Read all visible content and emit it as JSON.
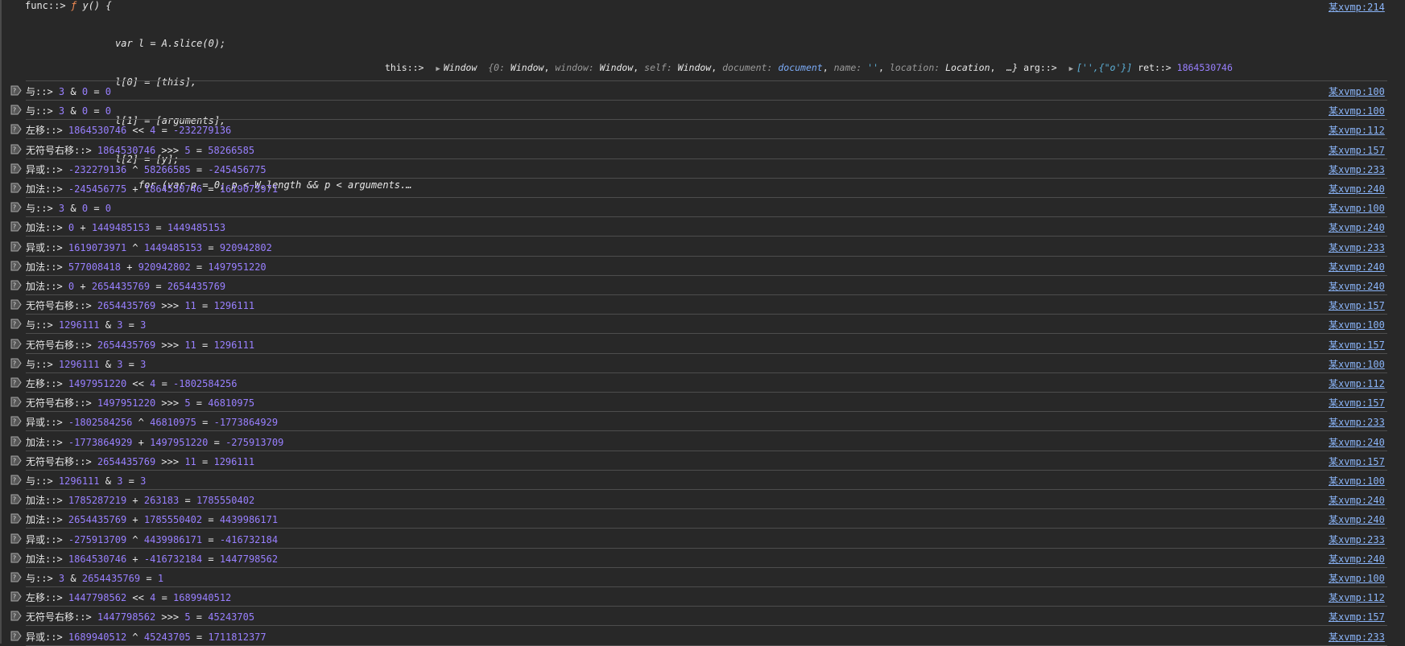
{
  "first": {
    "label": "func::>",
    "fn_keyword": "ƒ",
    "fn_sig": "y() {",
    "code_lines": [
      "var l = A.slice(0);",
      "l[0] = [this],",
      "l[1] = [arguments],",
      "l[2] = [y];",
      "for (var p = 0; p < W.length && p < arguments.…"
    ],
    "this_label": "this::>",
    "window_name": "Window",
    "window_preview": {
      "open": "{0: ",
      "v0": "Window",
      "k1": "window: ",
      "v1": "Window",
      "k2": "self: ",
      "v2": "Window",
      "k3": "document: ",
      "v3": "document",
      "k4": "name: ",
      "v4": "''",
      "k5": "location: ",
      "v5": "Location",
      "close": "…}"
    },
    "arg_label": "arg::>",
    "arg_value": "['',{\"o'}]",
    "ret_label": "ret::>",
    "ret_value": "1864530746",
    "link": "某xvmp:214"
  },
  "rows": [
    {
      "label": "与::>",
      "a": "3",
      "op": "&",
      "b": "0",
      "r": "0",
      "link": "某xvmp:100"
    },
    {
      "label": "与::>",
      "a": "3",
      "op": "&",
      "b": "0",
      "r": "0",
      "link": "某xvmp:100"
    },
    {
      "label": "左移::>",
      "a": "1864530746",
      "op": "<<",
      "b": "4",
      "r": "-232279136",
      "link": "某xvmp:112"
    },
    {
      "label": "无符号右移::>",
      "a": "1864530746",
      "op": ">>>",
      "b": "5",
      "r": "58266585",
      "link": "某xvmp:157"
    },
    {
      "label": "异或::>",
      "a": "-232279136",
      "op": "^",
      "b": "58266585",
      "r": "-245456775",
      "link": "某xvmp:233"
    },
    {
      "label": "加法::>",
      "a": "-245456775",
      "op": "+",
      "b": "1864530746",
      "r": "1619073971",
      "link": "某xvmp:240"
    },
    {
      "label": "与::>",
      "a": "3",
      "op": "&",
      "b": "0",
      "r": "0",
      "link": "某xvmp:100"
    },
    {
      "label": "加法::>",
      "a": "0",
      "op": "+",
      "b": "1449485153",
      "r": "1449485153",
      "link": "某xvmp:240"
    },
    {
      "label": "异或::>",
      "a": "1619073971",
      "op": "^",
      "b": "1449485153",
      "r": "920942802",
      "link": "某xvmp:233"
    },
    {
      "label": "加法::>",
      "a": "577008418",
      "op": "+",
      "b": "920942802",
      "r": "1497951220",
      "link": "某xvmp:240"
    },
    {
      "label": "加法::>",
      "a": "0",
      "op": "+",
      "b": "2654435769",
      "r": "2654435769",
      "link": "某xvmp:240"
    },
    {
      "label": "无符号右移::>",
      "a": "2654435769",
      "op": ">>>",
      "b": "11",
      "r": "1296111",
      "link": "某xvmp:157"
    },
    {
      "label": "与::>",
      "a": "1296111",
      "op": "&",
      "b": "3",
      "r": "3",
      "link": "某xvmp:100"
    },
    {
      "label": "无符号右移::>",
      "a": "2654435769",
      "op": ">>>",
      "b": "11",
      "r": "1296111",
      "link": "某xvmp:157"
    },
    {
      "label": "与::>",
      "a": "1296111",
      "op": "&",
      "b": "3",
      "r": "3",
      "link": "某xvmp:100"
    },
    {
      "label": "左移::>",
      "a": "1497951220",
      "op": "<<",
      "b": "4",
      "r": "-1802584256",
      "link": "某xvmp:112"
    },
    {
      "label": "无符号右移::>",
      "a": "1497951220",
      "op": ">>>",
      "b": "5",
      "r": "46810975",
      "link": "某xvmp:157"
    },
    {
      "label": "异或::>",
      "a": "-1802584256",
      "op": "^",
      "b": "46810975",
      "r": "-1773864929",
      "link": "某xvmp:233"
    },
    {
      "label": "加法::>",
      "a": "-1773864929",
      "op": "+",
      "b": "1497951220",
      "r": "-275913709",
      "link": "某xvmp:240"
    },
    {
      "label": "无符号右移::>",
      "a": "2654435769",
      "op": ">>>",
      "b": "11",
      "r": "1296111",
      "link": "某xvmp:157"
    },
    {
      "label": "与::>",
      "a": "1296111",
      "op": "&",
      "b": "3",
      "r": "3",
      "link": "某xvmp:100"
    },
    {
      "label": "加法::>",
      "a": "1785287219",
      "op": "+",
      "b": "263183",
      "r": "1785550402",
      "link": "某xvmp:240"
    },
    {
      "label": "加法::>",
      "a": "2654435769",
      "op": "+",
      "b": "1785550402",
      "r": "4439986171",
      "link": "某xvmp:240"
    },
    {
      "label": "异或::>",
      "a": "-275913709",
      "op": "^",
      "b": "4439986171",
      "r": "-416732184",
      "link": "某xvmp:233"
    },
    {
      "label": "加法::>",
      "a": "1864530746",
      "op": "+",
      "b": "-416732184",
      "r": "1447798562",
      "link": "某xvmp:240"
    },
    {
      "label": "与::>",
      "a": "3",
      "op": "&",
      "b": "2654435769",
      "r": "1",
      "link": "某xvmp:100"
    },
    {
      "label": "左移::>",
      "a": "1447798562",
      "op": "<<",
      "b": "4",
      "r": "1689940512",
      "link": "某xvmp:112"
    },
    {
      "label": "无符号右移::>",
      "a": "1447798562",
      "op": ">>>",
      "b": "5",
      "r": "45243705",
      "link": "某xvmp:157"
    },
    {
      "label": "异或::>",
      "a": "1689940512",
      "op": "^",
      "b": "45243705",
      "r": "1711812377",
      "link": "某xvmp:233"
    }
  ],
  "equals": "=",
  "colors": {
    "background": "#282828",
    "number": "#9980ff",
    "link": "#8ab4f8",
    "function_keyword": "#f28b54"
  }
}
